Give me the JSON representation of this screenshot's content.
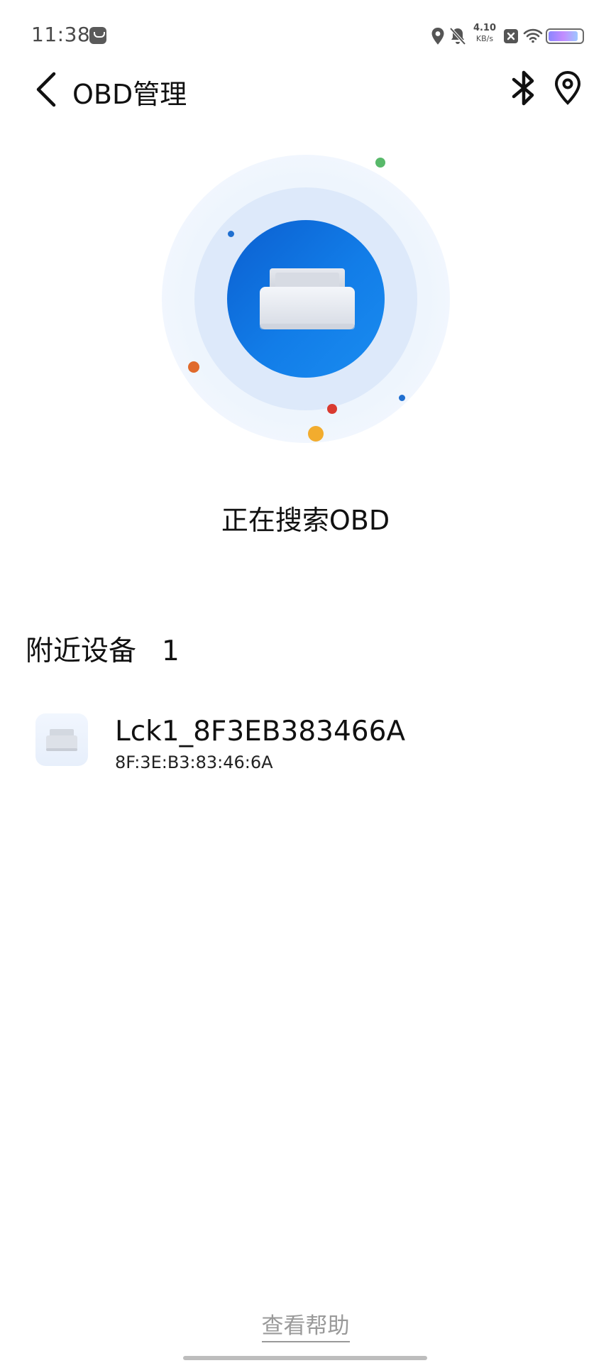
{
  "status_bar": {
    "time": "11:38",
    "net_speed_value": "4.10",
    "net_speed_unit": "KB/s",
    "icons": [
      "notification-app-icon",
      "location-icon",
      "bell-muted-icon",
      "speed-readout",
      "sim-off-icon",
      "wifi-icon",
      "battery-icon"
    ],
    "battery_level": 0.9
  },
  "header": {
    "title": "OBD管理",
    "back_icon": "chevron-left-icon",
    "bluetooth_icon": "bluetooth-icon",
    "location_icon": "location-pin-icon"
  },
  "radar": {
    "status_text": "正在搜索OBD",
    "colors": {
      "core": "#127de8",
      "mid_ring": "#dde9fa",
      "outer_ring": "#eef5fd",
      "dot_green": "#58b96a",
      "dot_blue": "#1f6fd0",
      "dot_orange": "#e06a2c",
      "dot_red": "#d93a30",
      "dot_yellow": "#f2ac2e"
    }
  },
  "nearby": {
    "label": "附近设备",
    "count": "1",
    "devices": [
      {
        "name": "Lck1_8F3EB383466A",
        "mac": "8F:3E:B3:83:46:6A",
        "icon": "obd-device-icon"
      }
    ]
  },
  "footer": {
    "help_label": "查看帮助"
  }
}
